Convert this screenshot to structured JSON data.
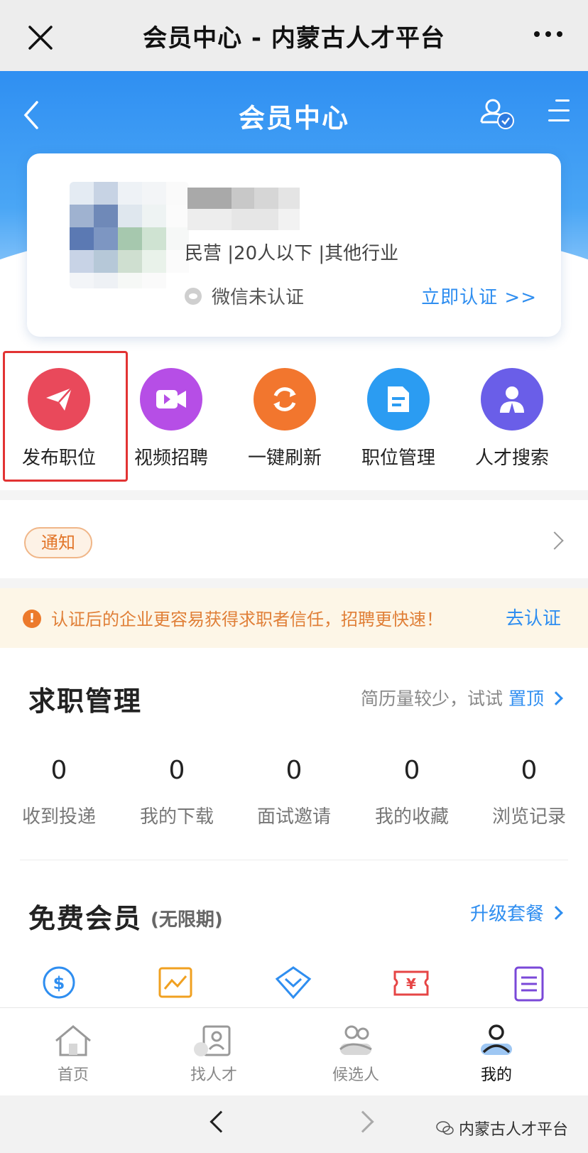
{
  "window": {
    "title": "会员中心 - 内蒙古人才平台"
  },
  "header": {
    "title": "会员中心"
  },
  "profile": {
    "company_meta": "民营 |20人以下 |其他行业",
    "wechat_status": "微信未认证",
    "verify_link": "立即认证 >>"
  },
  "quick_actions": [
    {
      "label": "发布职位",
      "icon": "paper-plane-icon",
      "color": "#e9495b"
    },
    {
      "label": "视频招聘",
      "icon": "video-camera-icon",
      "color": "#b64ee6"
    },
    {
      "label": "一键刷新",
      "icon": "refresh-icon",
      "color": "#f2762e"
    },
    {
      "label": "职位管理",
      "icon": "document-icon",
      "color": "#2b9cf2"
    },
    {
      "label": "人才搜索",
      "icon": "person-search-icon",
      "color": "#6a5ee8"
    }
  ],
  "notice": {
    "badge": "通知"
  },
  "tip": {
    "icon_text": "!",
    "text": "认证后的企业更容易获得求职者信任，招聘更快速！",
    "action": "去认证"
  },
  "job_management": {
    "title": "求职管理",
    "hint_prefix": "简历量较少，试试",
    "hint_action": "置顶",
    "stats": [
      {
        "value": "0",
        "label": "收到投递"
      },
      {
        "value": "0",
        "label": "我的下载"
      },
      {
        "value": "0",
        "label": "面试邀请"
      },
      {
        "value": "0",
        "label": "我的收藏"
      },
      {
        "value": "0",
        "label": "浏览记录"
      }
    ]
  },
  "membership": {
    "title": "免费会员",
    "period": "(无限期)",
    "upgrade": "升级套餐",
    "icons": [
      "dollar-coin-icon",
      "trend-chart-icon",
      "diamond-icon",
      "yen-ticket-icon",
      "list-clipboard-icon"
    ],
    "icon_colors": [
      "#2f8ef0",
      "#f0a020",
      "#2f8ef0",
      "#e64545",
      "#7a48d8"
    ]
  },
  "tabbar": {
    "items": [
      {
        "label": "首页",
        "icon": "home-icon"
      },
      {
        "label": "找人才",
        "icon": "find-talent-icon"
      },
      {
        "label": "候选人",
        "icon": "candidates-icon"
      },
      {
        "label": "我的",
        "icon": "profile-icon"
      }
    ],
    "active": "我的"
  },
  "browser": {
    "watermark": "内蒙古人才平台"
  },
  "colors": {
    "accent": "#2f8ef0",
    "highlight": "#e23333"
  }
}
